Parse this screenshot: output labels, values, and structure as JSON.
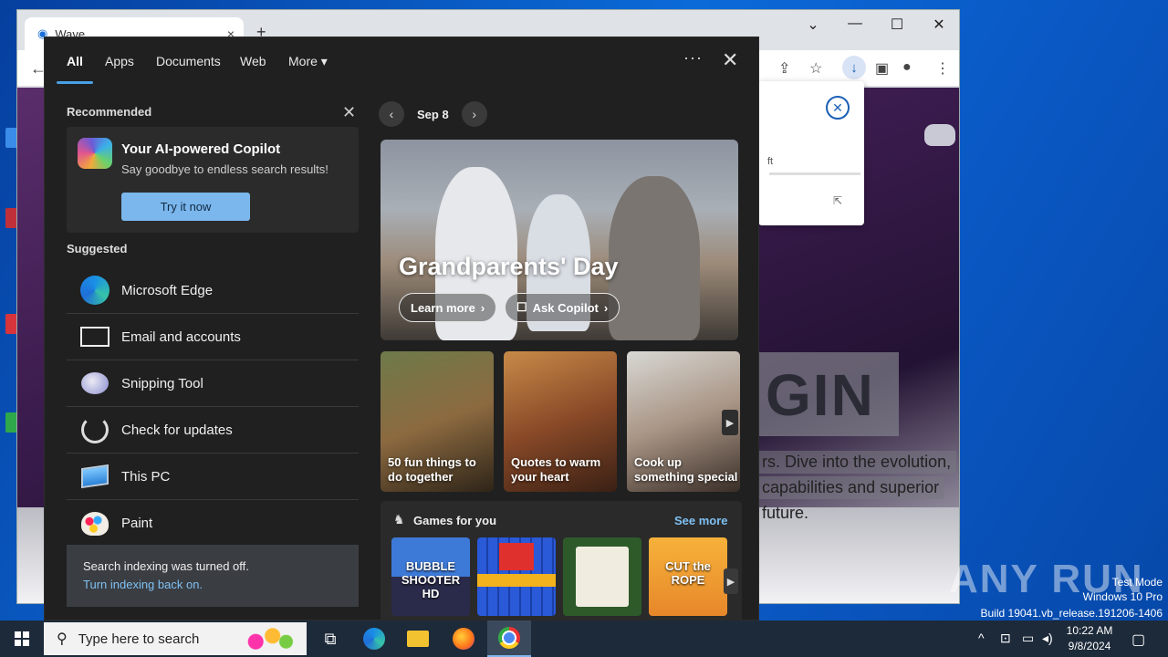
{
  "browser": {
    "tab_title": "Wave",
    "tab_close": "×",
    "new_tab": "+",
    "window_controls": [
      "⌄",
      "—",
      "☐",
      "✕"
    ]
  },
  "page": {
    "hero_word": "GIN",
    "hero_lines": [
      "rs. Dive into the evolution,",
      "capabilities and superior",
      "future."
    ],
    "download_popup_text": "ft"
  },
  "panel": {
    "tabs": [
      "All",
      "Apps",
      "Documents",
      "Web",
      "More"
    ],
    "more_caret": "▾",
    "menu_icon": "···",
    "close_icon": "✕",
    "recommended": {
      "title": "Recommended",
      "close": "✕",
      "card_title": "Your AI-powered Copilot",
      "card_subtitle": "Say goodbye to endless search results!",
      "button": "Try it now"
    },
    "suggested": {
      "title": "Suggested",
      "items": [
        {
          "label": "Microsoft Edge",
          "icon": "edge-icon"
        },
        {
          "label": "Email and accounts",
          "icon": "mail-icon"
        },
        {
          "label": "Snipping Tool",
          "icon": "snipping-tool-icon"
        },
        {
          "label": "Check for updates",
          "icon": "update-icon"
        },
        {
          "label": "This PC",
          "icon": "pc-icon"
        },
        {
          "label": "Paint",
          "icon": "paint-icon"
        }
      ]
    },
    "indexing": {
      "message": "Search indexing was turned off.",
      "link": "Turn indexing back on."
    },
    "date": "Sep 8",
    "hero": {
      "title": "Grandparents' Day",
      "learn_more": "Learn more",
      "ask_copilot": "Ask Copilot"
    },
    "cards": [
      {
        "text": "50 fun things to do together"
      },
      {
        "text": "Quotes to warm your heart"
      },
      {
        "text": "Cook up something special"
      }
    ],
    "games": {
      "title": "Games for you",
      "see_more": "See more",
      "items": [
        "BUBBLE SHOOTER HD",
        "",
        "",
        "CUT the ROPE"
      ]
    }
  },
  "taskbar": {
    "search_placeholder": "Type here to search",
    "time": "10:22 AM",
    "date": "9/8/2024",
    "watermark": "ANY RUN",
    "os_lines": [
      "Test Mode",
      "Windows 10 Pro",
      "Build 19041.vb_release.191206-1406"
    ]
  }
}
